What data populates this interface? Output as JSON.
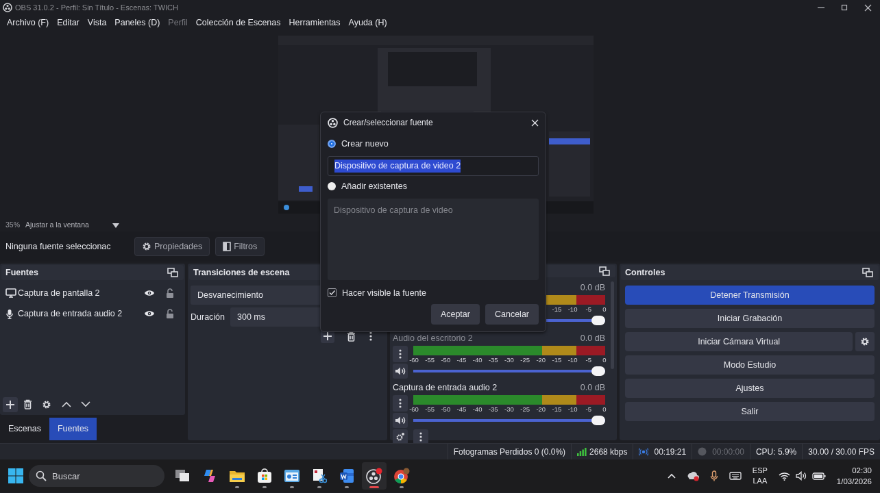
{
  "window": {
    "title": "OBS 31.0.2 - Perfil: Sin Título - Escenas: TWICH"
  },
  "menu": [
    {
      "label": "Archivo (F)",
      "disabled": false
    },
    {
      "label": "Editar",
      "disabled": false
    },
    {
      "label": "Vista",
      "disabled": false
    },
    {
      "label": "Paneles (D)",
      "disabled": false
    },
    {
      "label": "Perfil",
      "disabled": true
    },
    {
      "label": "Colección de Escenas",
      "disabled": false
    },
    {
      "label": "Herramientas",
      "disabled": false
    },
    {
      "label": "Ayuda (H)",
      "disabled": false
    }
  ],
  "zoom_bar": {
    "zoom": "35%",
    "fit": "Ajustar a la ventana"
  },
  "context_bar": {
    "selection": "Ninguna fuente seleccionac",
    "buttons": [
      {
        "label": "Propiedades"
      },
      {
        "label": "Filtros"
      }
    ]
  },
  "sources_dock": {
    "title": "Fuentes",
    "items": [
      {
        "label": "Captura de pantalla 2",
        "kind": "screen",
        "visible": true,
        "locked": false
      },
      {
        "label": "Captura de entrada audio 2",
        "kind": "audio",
        "visible": true,
        "locked": false
      }
    ]
  },
  "bottom_tabs": [
    {
      "label": "Escenas",
      "selected": false
    },
    {
      "label": "Fuentes",
      "selected": true
    }
  ],
  "transitions_dock": {
    "title": "Transiciones de escena",
    "transition": "Desvanecimiento",
    "duration_label": "Duración",
    "duration": "300 ms"
  },
  "mixer": {
    "channels": [
      {
        "reading": "0.0 dB",
        "ticks": [
          "-15",
          "-10",
          "-5",
          "0"
        ],
        "level": 1
      },
      {
        "name": "Audio del escritorio 2",
        "dimmed": true,
        "reading": "0.0 dB",
        "ticks": [
          "-60",
          "-55",
          "-50",
          "-45",
          "-40",
          "-35",
          "-30",
          "-25",
          "-20",
          "-15",
          "-10",
          "-5",
          "0"
        ],
        "level": 1
      },
      {
        "name": "Captura de entrada audio 2",
        "dimmed": false,
        "reading": "0.0 dB",
        "ticks": [
          "-60",
          "-55",
          "-50",
          "-45",
          "-40",
          "-35",
          "-30",
          "-25",
          "-20",
          "-15",
          "-10",
          "-5",
          "0"
        ],
        "level": 1
      }
    ]
  },
  "controls_dock": {
    "title": "Controles",
    "buttons": [
      {
        "label": "Detener Transmisión",
        "active": true,
        "settings": false
      },
      {
        "label": "Iniciar Grabación",
        "active": false,
        "settings": false
      },
      {
        "label": "Iniciar Cámara Virtual",
        "active": false,
        "settings": true
      },
      {
        "label": "Modo Estudio",
        "active": false,
        "settings": false
      },
      {
        "label": "Ajustes",
        "active": false,
        "settings": false
      },
      {
        "label": "Salir",
        "active": false,
        "settings": false
      }
    ]
  },
  "status_bar": {
    "dropped_frames": "Fotogramas Perdidos 0 (0.0%)",
    "bitrate": "2668 kbps",
    "streaming": true,
    "stream_time": "00:19:21",
    "recording": false,
    "record_time": "00:00:00",
    "cpu": "CPU: 5.9%",
    "fps": "30.00 / 30.00 FPS"
  },
  "dialog": {
    "title": "Crear/seleccionar fuente",
    "options": [
      {
        "label": "Crear nuevo",
        "selected": true
      },
      {
        "label": "Añadir existentes",
        "selected": false
      }
    ],
    "name_value": "Dispositivo de captura de video 2",
    "text_selected": true,
    "existing": [
      {
        "label": "Dispositivo de captura de video",
        "disabled": true
      }
    ],
    "checkbox": {
      "label": "Hacer visible la fuente",
      "checked": true
    },
    "buttons": [
      "Aceptar",
      "Cancelar"
    ]
  },
  "taskbar": {
    "search": {
      "placeholder": "Buscar"
    },
    "apps": [
      {
        "kind": "taskview",
        "running": false,
        "active": false
      },
      {
        "kind": "copilot",
        "running": false,
        "active": false
      },
      {
        "kind": "folder",
        "running": true,
        "active": false
      },
      {
        "kind": "store",
        "running": true,
        "active": false
      },
      {
        "kind": "photos",
        "running": true,
        "active": false
      },
      {
        "kind": "snip",
        "running": true,
        "active": false
      },
      {
        "kind": "word",
        "running": true,
        "active": false
      },
      {
        "kind": "obs",
        "running": true,
        "active": true
      },
      {
        "kind": "chrome",
        "running": true,
        "active": false
      }
    ],
    "language": [
      "ESP",
      "LAA"
    ],
    "time": "02:30",
    "date": "1/03/2026"
  }
}
